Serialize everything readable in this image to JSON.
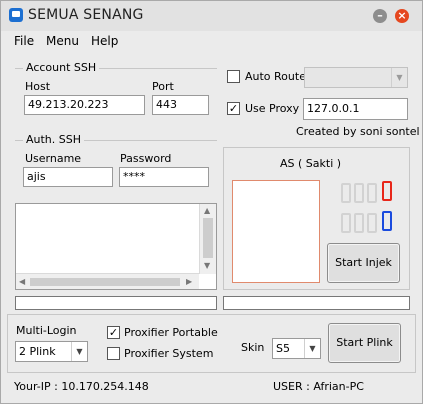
{
  "window": {
    "title": "SEMUA SENANG",
    "minimize_label": "–",
    "close_label": "×"
  },
  "menu": {
    "file": "File",
    "menu": "Menu",
    "help": "Help"
  },
  "account_ssh": {
    "group_label": "Account SSH",
    "host_label": "Host",
    "host_value": "49.213.20.223",
    "port_label": "Port",
    "port_value": "443"
  },
  "auth_ssh": {
    "group_label": "Auth. SSH",
    "username_label": "Username",
    "username_value": "ajis",
    "password_label": "Password",
    "password_value": "****"
  },
  "auto_route": {
    "label": "Auto Route",
    "checked": false,
    "selected": ""
  },
  "use_proxy": {
    "label": "Use Proxy",
    "checked": true,
    "value": "127.0.0.1",
    "check_glyph": "✓"
  },
  "credit": "Created by soni sontel",
  "sakti": {
    "title": "AS ( Sakti )",
    "digit_red": "0",
    "digit_blue": "0",
    "start_injek": "Start Injek"
  },
  "multi_login": {
    "label": "Multi-Login",
    "selected": "2 Plink"
  },
  "proxifier_portable": {
    "label": "Proxifier Portable",
    "checked": true
  },
  "proxifier_system": {
    "label": "Proxifier System",
    "checked": false
  },
  "skin": {
    "label": "Skin",
    "selected": "S5"
  },
  "start_plink": "Start Plink",
  "footer": {
    "your_ip": "Your-IP : 10.170.254.148",
    "user": "USER : Afrian-PC"
  },
  "colors": {
    "digit_red": "#e8271a",
    "digit_blue": "#1a4bde",
    "close": "#e5471f"
  }
}
